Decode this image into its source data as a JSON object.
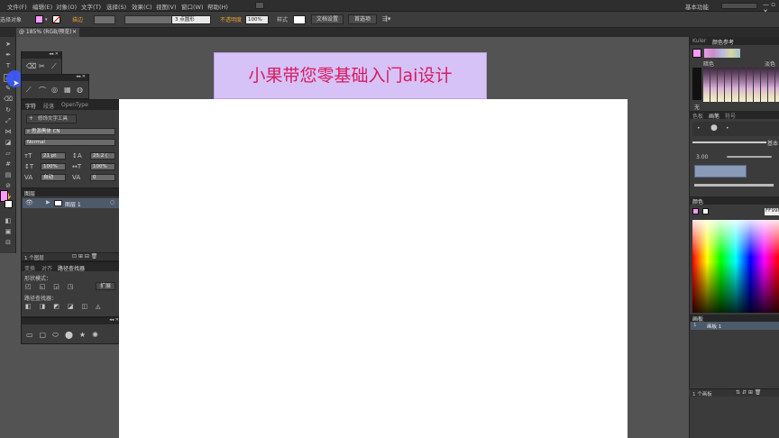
{
  "menu": [
    "文件(F)",
    "编辑(E)",
    "对象(O)",
    "文字(T)",
    "选择(S)",
    "效果(C)",
    "视图(V)",
    "窗口(W)",
    "帮助(H)"
  ],
  "workspace_label": "基本功能",
  "control_bar": {
    "selection_label": "选择对象",
    "stroke_label": "描边",
    "brush_value": "3 点圆形",
    "opacity_label": "不透明度",
    "opacity_value": "100%",
    "style_label": "样式",
    "doc_setup_button": "文档设置",
    "prefs_button": "首选项"
  },
  "document_tab": "@ 185% (RGB/预览)",
  "banner_text": "小果带您零基础入门ai设计",
  "character_panel": {
    "tabs": [
      "字符",
      "段落",
      "OpenType"
    ],
    "touch_tool": "修饰文字工具",
    "font_family": "思源黑体 CN",
    "font_style": "Normal",
    "font_size": "21 pt",
    "leading": "25.2 (",
    "horiz_scale": "100%",
    "vert_scale": "100%",
    "kerning": "自动",
    "tracking": "0"
  },
  "layers_panel": {
    "title": "图层",
    "layer_name": "图层 1",
    "footer": "1 个图层"
  },
  "pathfinder_panel": {
    "tabs": [
      "变换",
      "对齐",
      "路径查找器"
    ],
    "shape_modes": "形状模式：",
    "expand_button": "扩展",
    "pathfinders": "路径查找器："
  },
  "right_panels": {
    "kuler_tabs": [
      "Kuler",
      "颜色参考"
    ],
    "color_label": "暗色",
    "color_label_right": "淡色",
    "none_label": "无",
    "brush_tabs": [
      "色板",
      "画笔",
      "符号"
    ],
    "brush_basic": "基本",
    "brush_size": "3.00",
    "color_tab": "颜色",
    "hex_value": "FF99F",
    "artboards_title": "画板",
    "artboard_item": "画板 1",
    "artboard_footer": "1 个画板"
  },
  "colors": {
    "fill": "#ff99ff",
    "banner_bg": "#d6c2f7",
    "banner_text": "#d81b60",
    "accent_blue": "#3d5afe"
  }
}
